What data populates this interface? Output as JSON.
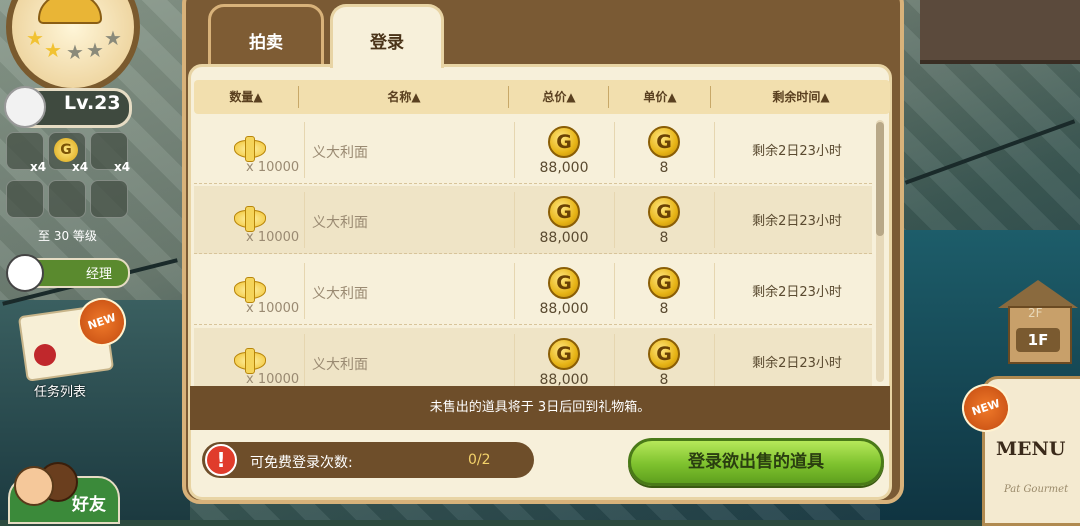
{
  "left_hud": {
    "level": "Lv.23",
    "items": [
      {
        "icon": "glove-icon",
        "count": "x4"
      },
      {
        "icon": "gold-coin-icon",
        "count": "x4"
      },
      {
        "icon": "boost-icon",
        "count": "x4"
      }
    ],
    "coin_mark": "G",
    "next_level_hint": "至 30 等级",
    "rank": "经理",
    "new_badge": "NEW",
    "quest_label": "任务列表",
    "friends_label": "好友"
  },
  "right_hud": {
    "floor_upper": "2F",
    "floor_current": "1F",
    "new_badge": "NEW",
    "menu_label": "MENU",
    "menu_sub": "Pat Gourmet"
  },
  "tabs": {
    "auction": "拍卖",
    "register": "登录",
    "active": "register"
  },
  "table": {
    "columns": [
      "数量▲",
      "名称▲",
      "总价▲",
      "单价▲",
      "剩余时间▲"
    ],
    "coin_mark": "G",
    "rows": [
      {
        "qty": "x 10000",
        "name": "义大利面",
        "total": "88,000",
        "unit": "8",
        "remaining": "剩余2日23小时"
      },
      {
        "qty": "x 10000",
        "name": "义大利面",
        "total": "88,000",
        "unit": "8",
        "remaining": "剩余2日23小时"
      },
      {
        "qty": "x 10000",
        "name": "义大利面",
        "total": "88,000",
        "unit": "8",
        "remaining": "剩余2日23小时"
      },
      {
        "qty": "x 10000",
        "name": "义大利面",
        "total": "88,000",
        "unit": "8",
        "remaining": "剩余2日23小时"
      }
    ]
  },
  "notice": "未售出的道具将于 3日后回到礼物箱。",
  "footer": {
    "warning_mark": "!",
    "free_label": "可免费登录次数:",
    "free_count": "0/2",
    "register_button": "登录欲出售的道具"
  },
  "colors": {
    "panel_brown": "#7a5a34",
    "parchment": "#f7f0da",
    "gold": "#e7b416",
    "button_green": "#7ec22e",
    "warning_red": "#e03c2c"
  }
}
